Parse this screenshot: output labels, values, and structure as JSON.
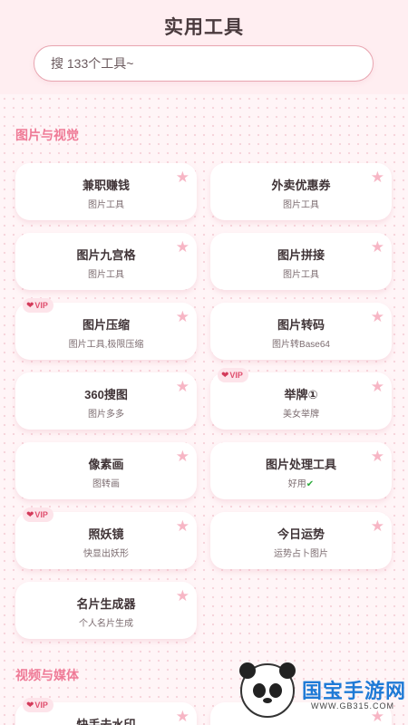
{
  "header": {
    "title": "实用工具",
    "search_placeholder": "搜 133个工具~"
  },
  "sections": [
    {
      "title": "图片与视觉"
    },
    {
      "title": "视频与媒体"
    }
  ],
  "tools": [
    {
      "name": "兼职赚钱",
      "desc": "图片工具",
      "vip": false
    },
    {
      "name": "外卖优惠券",
      "desc": "图片工具",
      "vip": false
    },
    {
      "name": "图片九宫格",
      "desc": "图片工具",
      "vip": false
    },
    {
      "name": "图片拼接",
      "desc": "图片工具",
      "vip": false
    },
    {
      "name": "图片压缩",
      "desc": "图片工具,极限压缩",
      "vip": true,
      "badge": "VIP"
    },
    {
      "name": "图片转码",
      "desc": "图片转Base64",
      "vip": false
    },
    {
      "name": "360搜图",
      "desc": "图片多多",
      "vip": false
    },
    {
      "name": "举牌①",
      "desc": "美女举牌",
      "vip": true,
      "badge": "VIP"
    },
    {
      "name": "像素画",
      "desc": "图转画",
      "vip": false
    },
    {
      "name": "图片处理工具",
      "desc": "好用",
      "vip": false,
      "check": "✔"
    },
    {
      "name": "照妖镜",
      "desc": "快显出妖形",
      "vip": true,
      "badge": "VIP"
    },
    {
      "name": "今日运势",
      "desc": "运势占卜图片",
      "vip": false
    },
    {
      "name": "名片生成器",
      "desc": "个人名片生成",
      "vip": false
    },
    {
      "name": "快手去水印",
      "desc": "",
      "vip": true,
      "badge": "VIP"
    }
  ],
  "icons": {
    "star": "star-icon",
    "heart": "heart-icon"
  },
  "colors": {
    "accent": "#ef7b97",
    "star": "#f7b6c5",
    "vip": "#e0506f"
  },
  "watermark": {
    "logo": "国宝手游网",
    "url": "WWW.GB315.COM"
  }
}
